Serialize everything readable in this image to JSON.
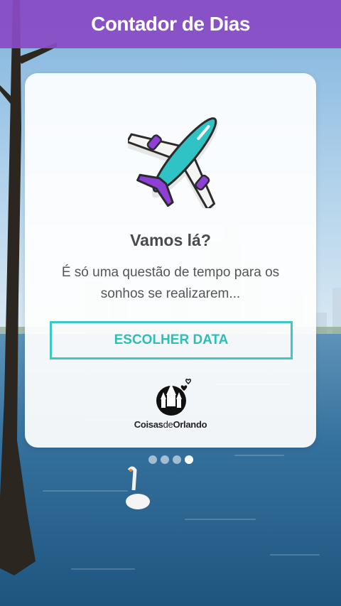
{
  "header": {
    "title": "Contador de Dias"
  },
  "card": {
    "title": "Vamos lá?",
    "subtitle": "É só uma questão de tempo para os sonhos se realizarem...",
    "button_label": "ESCOLHER DATA",
    "plane_icon": "airplane-icon",
    "logo": {
      "word1": "Coisas",
      "word2": "de",
      "word3": "Orlando"
    }
  },
  "pager": {
    "total": 4,
    "active_index": 3
  },
  "colors": {
    "header": "#894ac4",
    "accent": "#3cc8c5",
    "plane_body": "#2fc3c6",
    "plane_wing": "#8e3fd6"
  }
}
